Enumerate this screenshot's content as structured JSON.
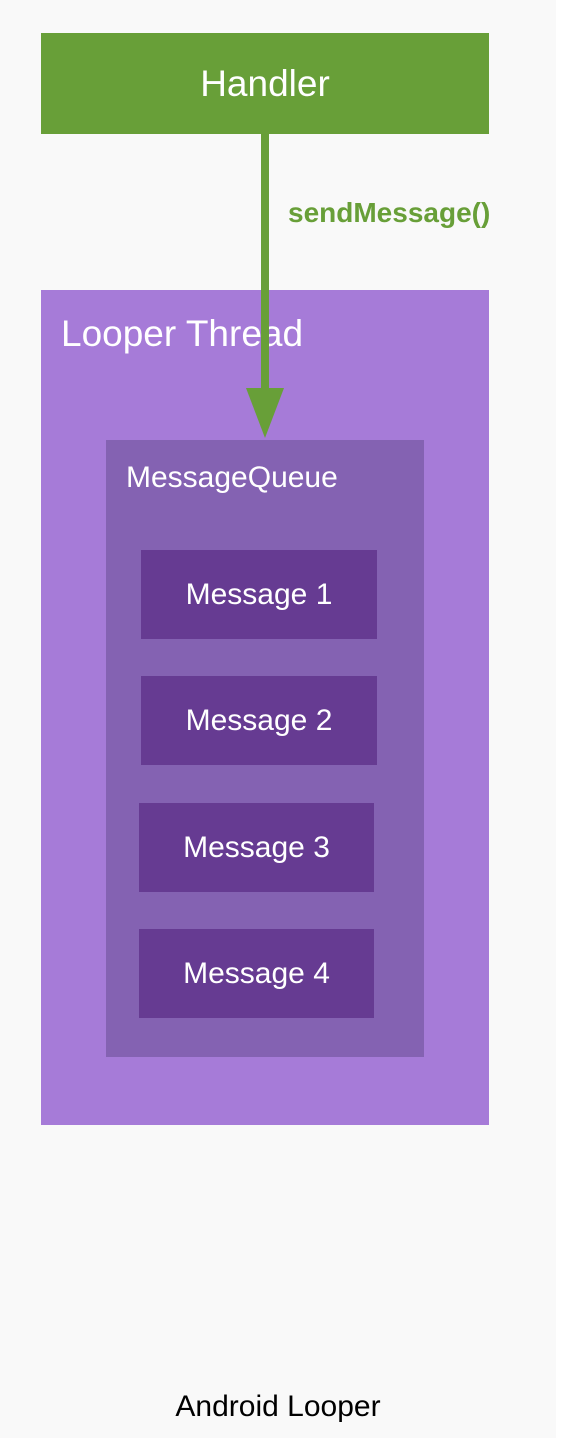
{
  "diagram": {
    "caption": "Android Looper",
    "handler": {
      "label": "Handler"
    },
    "arrow": {
      "label": "sendMessage()"
    },
    "looper_thread": {
      "label": "Looper Thread"
    },
    "message_queue": {
      "label": "MessageQueue",
      "messages": [
        "Message 1",
        "Message 2",
        "Message 3",
        "Message 4"
      ]
    }
  },
  "colors": {
    "handler": "#689f38",
    "looper_thread": "#a67bd8",
    "message_queue": "#8462b2",
    "message": "#663b92",
    "background": "#f9f9f9"
  }
}
